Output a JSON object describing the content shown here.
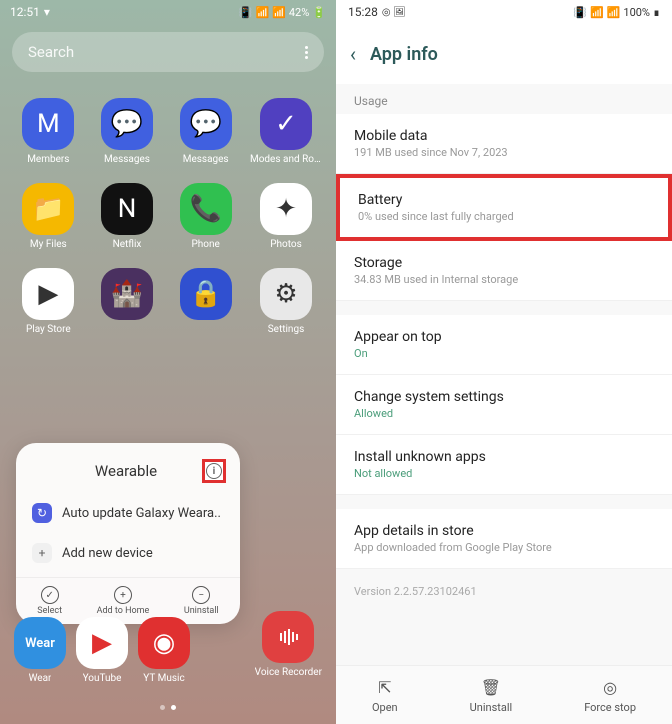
{
  "left": {
    "status": {
      "time": "12:51",
      "battery": "42%"
    },
    "search": {
      "placeholder": "Search"
    },
    "apps": [
      {
        "label": "Members",
        "bg": "#4060e0",
        "glyph": "M"
      },
      {
        "label": "Messages",
        "bg": "#4060e0",
        "glyph": "💬"
      },
      {
        "label": "Messages",
        "bg": "#4060e0",
        "glyph": "💬"
      },
      {
        "label": "Modes and Rout..",
        "bg": "#5040c0",
        "glyph": "✓"
      },
      {
        "label": "My Files",
        "bg": "#f5b800",
        "glyph": "📁"
      },
      {
        "label": "Netflix",
        "bg": "#111",
        "glyph": "N"
      },
      {
        "label": "Phone",
        "bg": "#30c050",
        "glyph": "📞"
      },
      {
        "label": "Photos",
        "bg": "#fff",
        "glyph": "✦"
      },
      {
        "label": "Play Store",
        "bg": "#fff",
        "glyph": "▶"
      },
      {
        "label": "",
        "bg": "#4a3060",
        "glyph": "🏰"
      },
      {
        "label": "",
        "bg": "#3050d0",
        "glyph": "🔒"
      },
      {
        "label": "Settings",
        "bg": "#e8e8e8",
        "glyph": "⚙"
      }
    ],
    "voiceRecorder": {
      "label": "Voice Recorder",
      "bg": "#e04040"
    },
    "popup": {
      "title": "Wearable",
      "items": [
        {
          "label": "Auto update Galaxy Weara..",
          "iconBg": "#5060e0",
          "iconGlyph": "↻"
        },
        {
          "label": "Add new device",
          "iconBg": "#f0f0f0",
          "iconGlyph": "+"
        }
      ],
      "actions": [
        {
          "label": "Select",
          "glyph": "✓"
        },
        {
          "label": "Add to Home",
          "glyph": "+"
        },
        {
          "label": "Uninstall",
          "glyph": "−"
        }
      ]
    },
    "bottomApps": [
      {
        "label": "Wear",
        "bg": "#3090e0",
        "glyph": "Wear",
        "text": true
      },
      {
        "label": "YouTube",
        "bg": "#fff",
        "glyph": "▶"
      },
      {
        "label": "YT Music",
        "bg": "#e03030",
        "glyph": "◉"
      }
    ]
  },
  "right": {
    "status": {
      "time": "15:28",
      "battery": "100%"
    },
    "title": "App info",
    "usageLabel": "Usage",
    "items": {
      "mobileData": {
        "title": "Mobile data",
        "sub": "191 MB used since Nov 7, 2023"
      },
      "battery": {
        "title": "Battery",
        "sub": "0% used since last fully charged"
      },
      "storage": {
        "title": "Storage",
        "sub": "34.83 MB used in Internal storage"
      },
      "appearOnTop": {
        "title": "Appear on top",
        "sub": "On"
      },
      "changeSettings": {
        "title": "Change system settings",
        "sub": "Allowed"
      },
      "installUnknown": {
        "title": "Install unknown apps",
        "sub": "Not allowed"
      },
      "appDetails": {
        "title": "App details in store",
        "sub": "App downloaded from Google Play Store"
      }
    },
    "version": "Version 2.2.57.23102461",
    "bottomBar": {
      "open": "Open",
      "uninstall": "Uninstall",
      "forceStop": "Force stop"
    }
  }
}
